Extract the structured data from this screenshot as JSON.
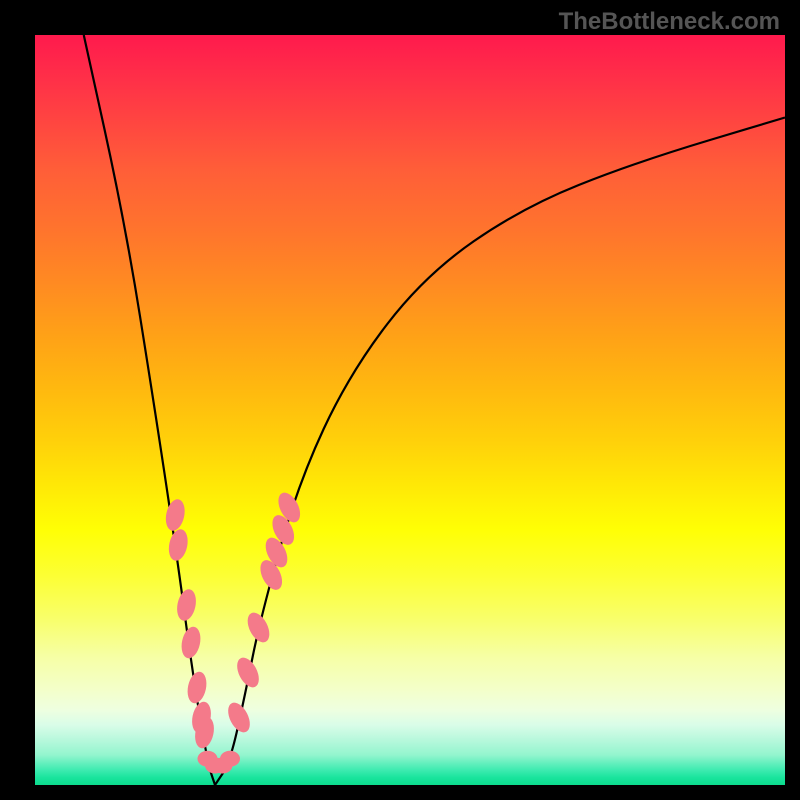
{
  "watermark": "TheBottleneck.com",
  "chart_data": {
    "type": "line",
    "title": "",
    "xlabel": "",
    "ylabel": "",
    "xlim": [
      0,
      100
    ],
    "ylim": [
      0,
      100
    ],
    "gradient_background": {
      "top_color": "#ff1a4d",
      "mid_color": "#ffff05",
      "bottom_color": "#0cdb8d"
    },
    "curve_vertex_x": 24,
    "curve_description": "V-shaped curve with steep left branch and shallow right branch meeting at x≈24 y≈0",
    "left_branch": [
      {
        "x": 6.5,
        "y": 100
      },
      {
        "x": 12,
        "y": 75
      },
      {
        "x": 16,
        "y": 50
      },
      {
        "x": 19,
        "y": 30
      },
      {
        "x": 21,
        "y": 15
      },
      {
        "x": 23,
        "y": 3
      },
      {
        "x": 24,
        "y": 0
      }
    ],
    "right_branch": [
      {
        "x": 24,
        "y": 0
      },
      {
        "x": 26,
        "y": 3
      },
      {
        "x": 28,
        "y": 12
      },
      {
        "x": 30,
        "y": 22
      },
      {
        "x": 35,
        "y": 40
      },
      {
        "x": 42,
        "y": 55
      },
      {
        "x": 52,
        "y": 68
      },
      {
        "x": 65,
        "y": 77
      },
      {
        "x": 80,
        "y": 83
      },
      {
        "x": 100,
        "y": 89
      }
    ],
    "marker_clusters_description": "Pink oblong markers clustered on both branches near the valley bottom between approximately y=7 and y=38",
    "left_branch_markers": [
      {
        "x": 18.7,
        "y": 36
      },
      {
        "x": 19.1,
        "y": 32
      },
      {
        "x": 20.2,
        "y": 24
      },
      {
        "x": 20.8,
        "y": 19
      },
      {
        "x": 21.6,
        "y": 13
      },
      {
        "x": 22.2,
        "y": 9
      },
      {
        "x": 22.6,
        "y": 7
      }
    ],
    "right_branch_markers": [
      {
        "x": 27.2,
        "y": 9
      },
      {
        "x": 28.4,
        "y": 15
      },
      {
        "x": 29.8,
        "y": 21
      },
      {
        "x": 31.5,
        "y": 28
      },
      {
        "x": 32.2,
        "y": 31
      },
      {
        "x": 33.1,
        "y": 34
      },
      {
        "x": 33.9,
        "y": 37
      }
    ],
    "bottom_markers": [
      {
        "x": 23.0,
        "y": 3.5
      },
      {
        "x": 24.0,
        "y": 2.6
      },
      {
        "x": 25.0,
        "y": 2.6
      },
      {
        "x": 26.0,
        "y": 3.5
      }
    ],
    "marker_color": "#f47a8a"
  }
}
